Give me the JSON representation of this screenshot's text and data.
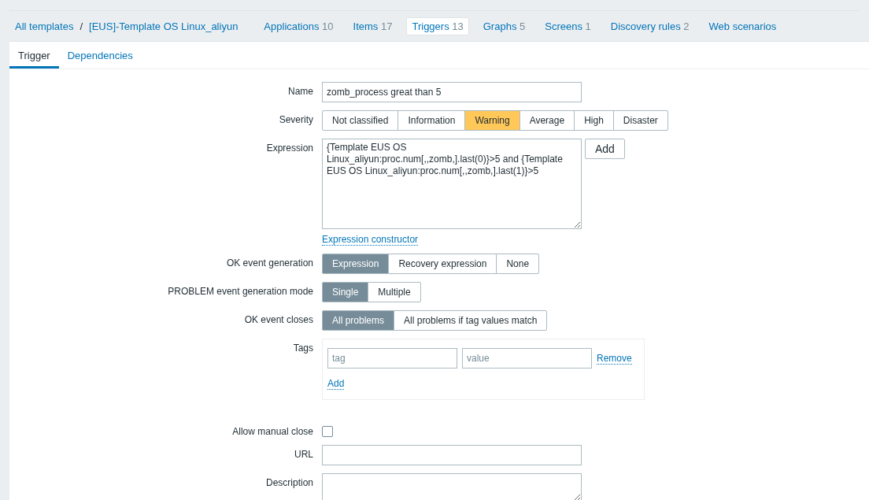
{
  "breadcrumbs": [
    {
      "label": "All templates"
    },
    {
      "label": "[EUS]-Template OS Linux_aliyun"
    }
  ],
  "breadcrumb_separator": "/",
  "nav": [
    {
      "label": "Applications",
      "count": "10",
      "selected": false
    },
    {
      "label": "Items",
      "count": "17",
      "selected": false
    },
    {
      "label": "Triggers",
      "count": "13",
      "selected": true
    },
    {
      "label": "Graphs",
      "count": "5",
      "selected": false
    },
    {
      "label": "Screens",
      "count": "1",
      "selected": false
    },
    {
      "label": "Discovery rules",
      "count": "2",
      "selected": false
    },
    {
      "label": "Web scenarios",
      "selected": false
    }
  ],
  "tabs": [
    {
      "label": "Trigger",
      "selected": true
    },
    {
      "label": "Dependencies",
      "selected": false
    }
  ],
  "form": {
    "name": {
      "label": "Name",
      "value": "zomb_process great than 5"
    },
    "severity": {
      "label": "Severity",
      "options": [
        {
          "label": "Not classified",
          "selected": false
        },
        {
          "label": "Information",
          "selected": false
        },
        {
          "label": "Warning",
          "selected": true
        },
        {
          "label": "Average",
          "selected": false
        },
        {
          "label": "High",
          "selected": false
        },
        {
          "label": "Disaster",
          "selected": false
        }
      ]
    },
    "expression": {
      "label": "Expression",
      "value": "{Template EUS OS Linux_aliyun:proc.num[,,zomb,].last(0)}>5 and {Template EUS OS Linux_aliyun:proc.num[,,zomb,].last(1)}>5",
      "add_button": "Add",
      "constructor_link": "Expression constructor"
    },
    "ok_event_generation": {
      "label": "OK event generation",
      "options": [
        {
          "label": "Expression",
          "selected": true
        },
        {
          "label": "Recovery expression",
          "selected": false
        },
        {
          "label": "None",
          "selected": false
        }
      ]
    },
    "problem_mode": {
      "label": "PROBLEM event generation mode",
      "options": [
        {
          "label": "Single",
          "selected": true
        },
        {
          "label": "Multiple",
          "selected": false
        }
      ]
    },
    "ok_event_closes": {
      "label": "OK event closes",
      "options": [
        {
          "label": "All problems",
          "selected": true
        },
        {
          "label": "All problems if tag values match",
          "selected": false
        }
      ]
    },
    "tags": {
      "label": "Tags",
      "tag_placeholder": "tag",
      "value_placeholder": "value",
      "remove_link": "Remove",
      "add_link": "Add"
    },
    "allow_manual_close": {
      "label": "Allow manual close",
      "checked": false
    },
    "url": {
      "label": "URL"
    },
    "description": {
      "label": "Description"
    }
  }
}
